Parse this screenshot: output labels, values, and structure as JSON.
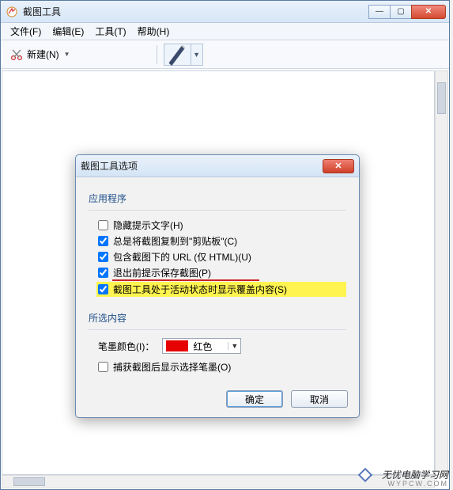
{
  "window": {
    "title": "截图工具",
    "controls": {
      "min": "—",
      "max": "▢",
      "close": "✕"
    }
  },
  "menu": {
    "file": "文件(F)",
    "edit": "编辑(E)",
    "tools": "工具(T)",
    "help": "帮助(H)"
  },
  "toolbar": {
    "new_label": "新建(N)"
  },
  "dialog": {
    "title": "截图工具选项",
    "close": "✕",
    "groups": {
      "app": "应用程序",
      "selection": "所选内容"
    },
    "options": {
      "hide_hint": "隐藏提示文字(H)",
      "copy_clipboard": "总是将截图复制到\"剪贴板\"(C)",
      "include_url": "包含截图下的 URL (仅 HTML)(U)",
      "prompt_save": "退出前提示保存截图(P)",
      "show_overlay": "截图工具处于活动状态时显示覆盖内容(S)",
      "ink_color_label": "笔墨颜色(I)：",
      "ink_color_value": "红色",
      "show_ink_after": "捕获截图后显示选择笔墨(O)"
    },
    "buttons": {
      "ok": "确定",
      "cancel": "取消"
    },
    "colors": {
      "red": "#e60000"
    }
  },
  "watermark": {
    "line1": "无忧电脑学习网",
    "line2": "WYPCW.COM"
  }
}
